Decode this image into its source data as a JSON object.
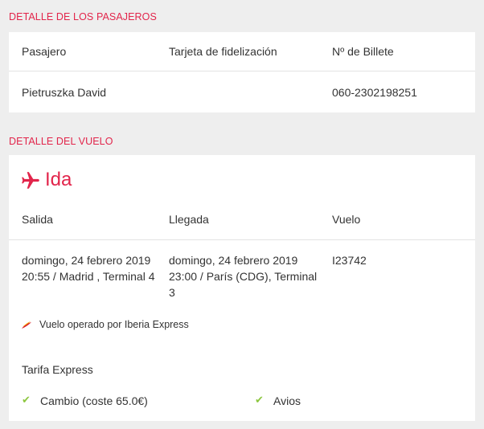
{
  "passengers_section": {
    "title": "DETALLE DE LOS PASAJEROS",
    "headers": {
      "passenger": "Pasajero",
      "loyalty": "Tarjeta de fidelización",
      "ticket": "Nº de Billete"
    },
    "rows": [
      {
        "passenger": "Pietruszka David",
        "loyalty": "",
        "ticket": "060-2302198251"
      }
    ]
  },
  "flight_section": {
    "title": "DETALLE DEL VUELO",
    "direction_icon": "airplane-icon",
    "direction_label": "Ida",
    "headers": {
      "departure": "Salida",
      "arrival": "Llegada",
      "flight": "Vuelo"
    },
    "departure": {
      "date": "domingo, 24 febrero 2019",
      "details": "20:55 / Madrid , Terminal 4"
    },
    "arrival": {
      "date": "domingo, 24 febrero 2019",
      "details_line1": "23:00 / París (CDG), Terminal",
      "details_line2": "3"
    },
    "flight_number": "I23742",
    "operator_icon": "iberia-logo",
    "operated_by": "Vuelo operado por Iberia Express",
    "fare_name": "Tarifa Express",
    "fare_features": [
      {
        "icon": "check-icon",
        "label": "Cambio (coste 65.0€)"
      },
      {
        "icon": "check-icon",
        "label": "Avios"
      }
    ]
  },
  "colors": {
    "accent": "#e2254b",
    "check": "#8cc63f",
    "background": "#eeeeee"
  }
}
